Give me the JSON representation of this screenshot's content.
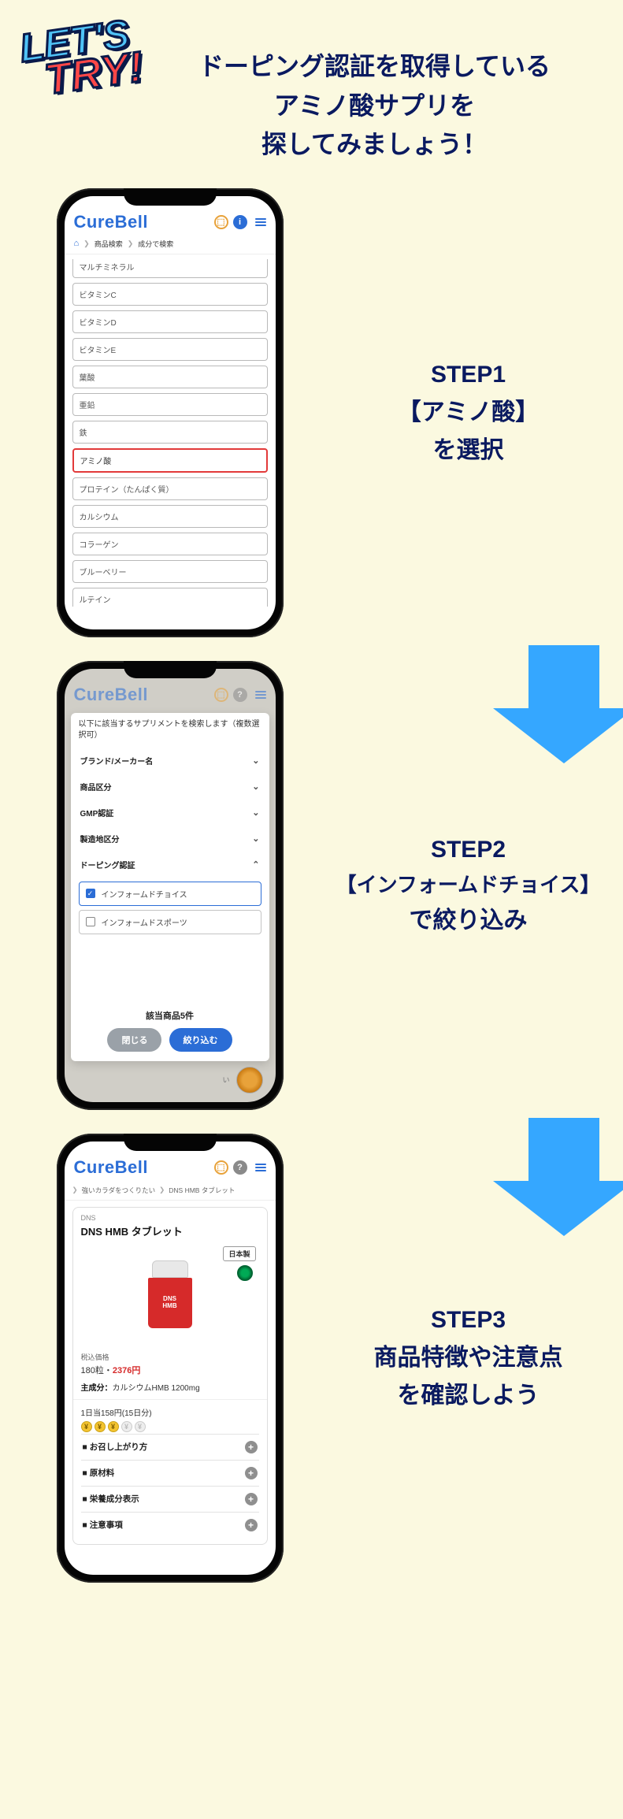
{
  "hero": {
    "lets": "LET'S",
    "try": "TRY!",
    "title_l1": "ドーピング認証を取得している",
    "title_l2": "アミノ酸サプリを",
    "title_l3": "探してみましょう！"
  },
  "brand": "CureBell",
  "step1": {
    "label_title": "STEP1",
    "label_l1": "【アミノ酸】",
    "label_l2": "を選択",
    "breadcrumbs": {
      "home": "⌂",
      "b1": "商品検索",
      "b2": "成分で検索"
    },
    "options": [
      "マルチミネラル",
      "ビタミンC",
      "ビタミンD",
      "ビタミンE",
      "葉酸",
      "亜鉛",
      "鉄",
      "アミノ酸",
      "プロテイン（たんぱく質）",
      "カルシウム",
      "コラーゲン",
      "ブルーベリー",
      "ルテイン"
    ],
    "selected_index": 7
  },
  "step2": {
    "label_title": "STEP2",
    "label_l1": "【インフォームドチョイス】",
    "label_l2": "で絞り込み",
    "modal_title": "以下に該当するサプリメントを検索します（複数選択可）",
    "accordions": [
      {
        "label": "ブランド/メーカー名",
        "open": false
      },
      {
        "label": "商品区分",
        "open": false
      },
      {
        "label": "GMP認証",
        "open": false
      },
      {
        "label": "製造地区分",
        "open": false
      },
      {
        "label": "ドーピング認証",
        "open": true
      }
    ],
    "doping_options": [
      {
        "label": "インフォームドチョイス",
        "checked": true
      },
      {
        "label": "インフォームドスポーツ",
        "checked": false
      }
    ],
    "result_count": "該当商品5件",
    "btn_close": "閉じる",
    "btn_apply": "絞り込む",
    "blur_text": "い"
  },
  "step3": {
    "label_title": "STEP3",
    "label_l1": "商品特徴や注意点",
    "label_l2": "を確認しよう",
    "breadcrumbs": {
      "b1": "強いカラダをつくりたい",
      "b2": "DNS HMB タブレット"
    },
    "maker": "DNS",
    "product_name": "DNS HMB タブレット",
    "badge_jp": "日本製",
    "jar_l1": "DNS",
    "jar_l2": "HMB",
    "price_label": "税込価格",
    "price_qty": "180粒",
    "price_dot": "・",
    "price_val": "2376円",
    "main_ingredient_label": "主成分：",
    "main_ingredient": "カルシウムHMB 1200mg",
    "per_day": "1日当158円(15日分)",
    "coin_glyph": "¥",
    "coins_active": 3,
    "coins_total": 5,
    "accordions": [
      "お召し上がり方",
      "原材料",
      "栄養成分表示",
      "注意事項"
    ],
    "sq": "■ "
  }
}
